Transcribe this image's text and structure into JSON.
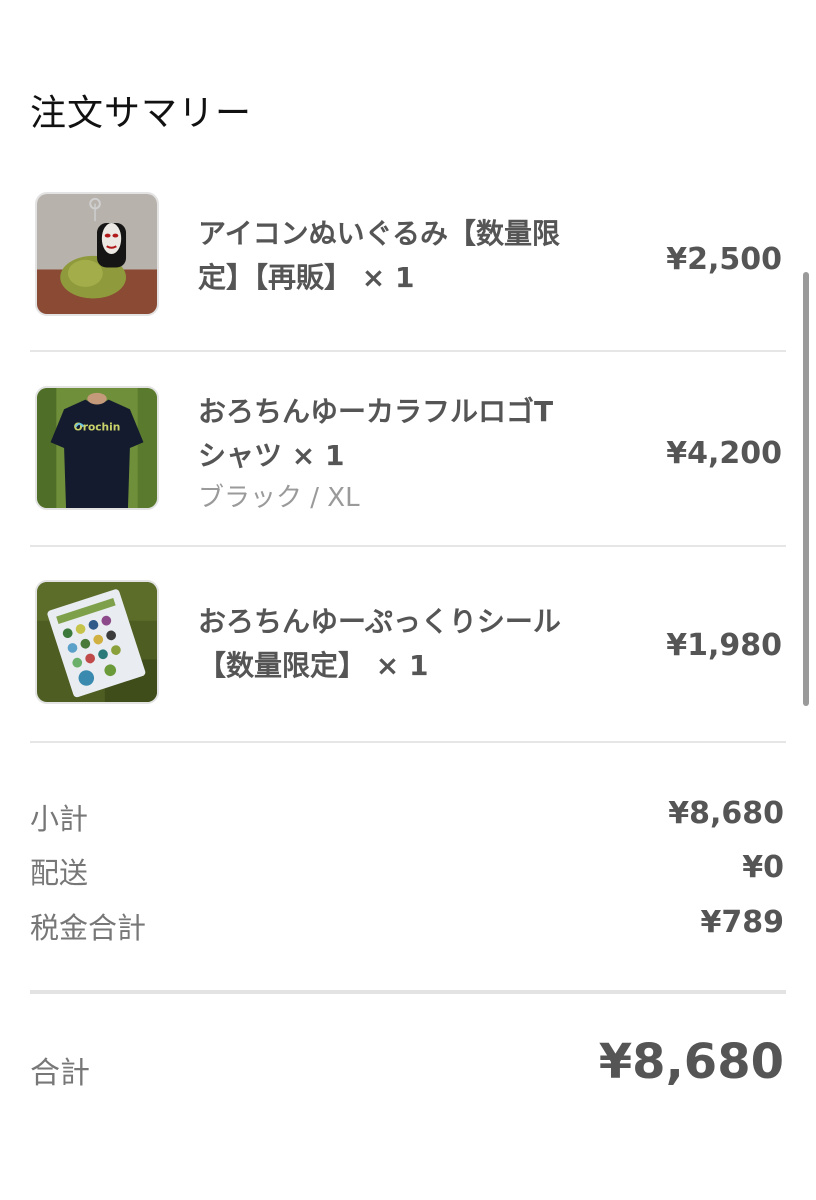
{
  "title": "注文サマリー",
  "items": [
    {
      "name_line1": "アイコンぬいぐるみ【数量限",
      "name_line2": "定】【再販】 × 1",
      "variant": "",
      "price": "¥2,500",
      "thumb_icon": "plush-toy-icon"
    },
    {
      "name_line1": "おろちんゆーカラフルロゴT",
      "name_line2": "シャツ × 1",
      "variant": "ブラック / XL",
      "price": "¥4,200",
      "thumb_icon": "tshirt-icon",
      "thumb_logo_text": "Orochin"
    },
    {
      "name_line1": "おろちんゆーぷっくりシール",
      "name_line2": "【数量限定】 × 1",
      "variant": "",
      "price": "¥1,980",
      "thumb_icon": "sticker-sheet-icon"
    }
  ],
  "summary": {
    "subtotal_label": "小計",
    "subtotal_value": "¥8,680",
    "shipping_label": "配送",
    "shipping_value": "¥0",
    "tax_label": "税金合計",
    "tax_value": "¥789"
  },
  "total": {
    "label": "合計",
    "value": "¥8,680"
  }
}
